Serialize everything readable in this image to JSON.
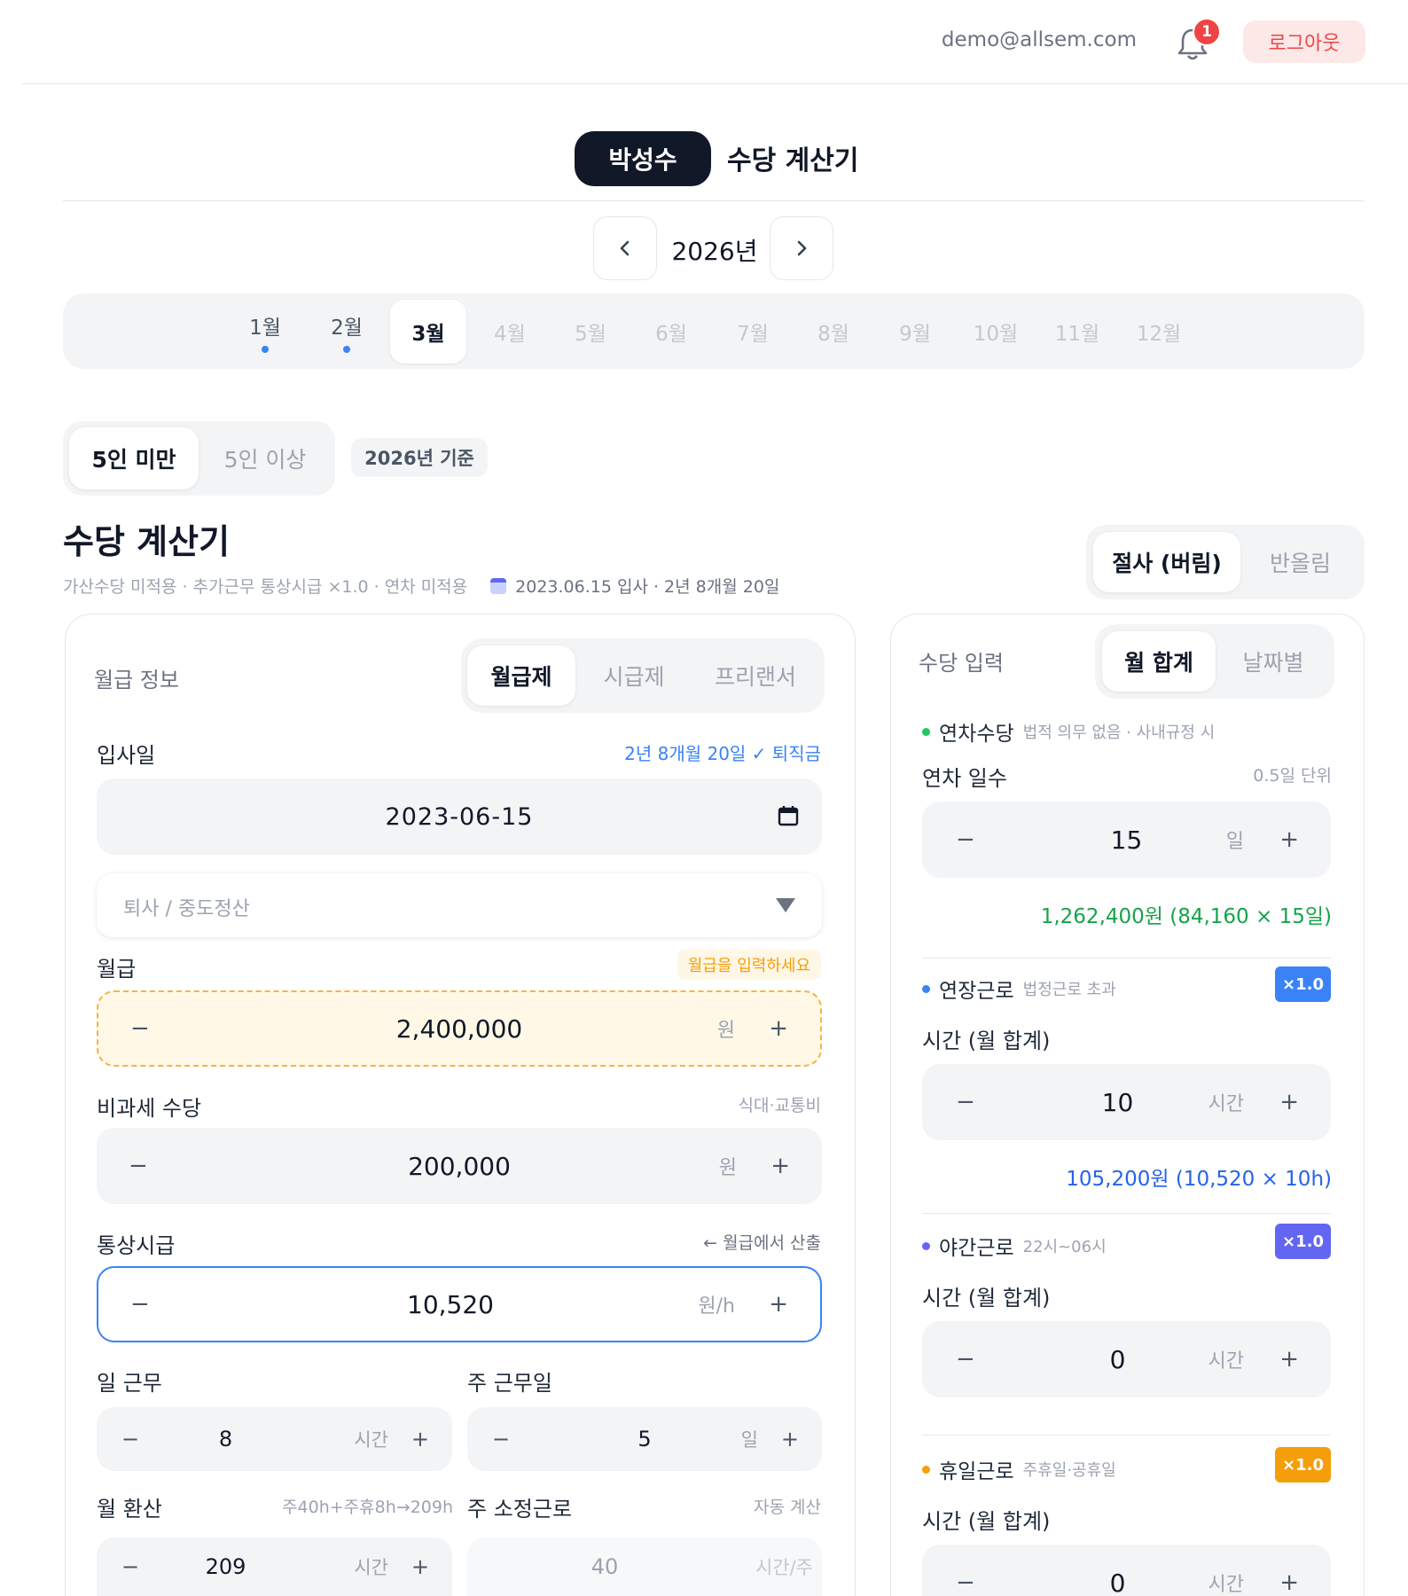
{
  "topbar": {
    "email": "demo@allsem.com",
    "notif_count": "1",
    "logout": "로그아웃"
  },
  "header": {
    "name": "박성수",
    "title": "수당 계산기"
  },
  "year_nav": {
    "prev": "‹",
    "year": "2026년",
    "next": "›"
  },
  "months": [
    {
      "label": "1월",
      "dot": true
    },
    {
      "label": "2월",
      "dot": true
    },
    {
      "label": "3월",
      "active": true
    },
    {
      "label": "4월"
    },
    {
      "label": "5월"
    },
    {
      "label": "6월"
    },
    {
      "label": "7월"
    },
    {
      "label": "8월"
    },
    {
      "label": "9월"
    },
    {
      "label": "10월"
    },
    {
      "label": "11월"
    },
    {
      "label": "12월"
    }
  ],
  "size_toggle": {
    "under5": "5인 미만",
    "over5": "5인 이상",
    "selected": "5인 미만"
  },
  "standard_chip": "2026년 기준",
  "calc": {
    "title": "수당 계산기",
    "subtitle": "가산수당 미적용 · 추가근무 통상시급 ×1.0 · 연차 미적용",
    "hire_info": "2023.06.15 입사 · 2년 8개월 20일"
  },
  "rounding": {
    "floor": "절사 (버림)",
    "round": "반올림",
    "selected": "절사 (버림)"
  },
  "salary": {
    "section": "월급 정보",
    "types": [
      "월급제",
      "시급제",
      "프리랜서"
    ],
    "selected_type": "월급제",
    "hire_date_label": "입사일",
    "hire_date_hint": "2년 8개월 20일 ✓ 퇴직금",
    "hire_date": "2023-06-15",
    "resign_placeholder": "퇴사 / 중도정산",
    "monthly_label": "월급",
    "monthly_hint": "월급을 입력하세요",
    "monthly_value": "2,400,000",
    "won": "원",
    "nontax_label": "비과세 수당",
    "nontax_hint": "식대·교통비",
    "nontax_value": "200,000",
    "hourly_label": "통상시급",
    "hourly_hint": "← 월급에서 산출",
    "hourly_value": "10,520",
    "hourly_unit": "원/h",
    "daily_label": "일 근무",
    "daily_value": "8",
    "daily_unit": "시간",
    "weekdays_label": "주 근무일",
    "weekdays_value": "5",
    "weekdays_unit": "일",
    "monthly_hours_label": "월 환산",
    "monthly_hours_hint": "주40h+주휴8h→209h",
    "monthly_hours_value": "209",
    "monthly_hours_unit": "시간",
    "weekly_label": "주 소정근로",
    "weekly_hint": "자동 계산",
    "weekly_value": "40",
    "weekly_unit": "시간/주",
    "minus": "−",
    "plus": "+"
  },
  "allowance": {
    "section": "수당 입력",
    "modes": [
      "월 합계",
      "날짜별"
    ],
    "selected_mode": "월 합계",
    "items": [
      {
        "name": "연차수당",
        "desc": "법적 의무 없음 · 사내규정 시",
        "color": "#22c55e",
        "field_label": "연차 일수",
        "field_hint": "0.5일 단위",
        "value": "15",
        "unit": "일",
        "result": "1,262,400원 (84,160 × 15일)",
        "result_color": "#16a34a"
      },
      {
        "name": "연장근로",
        "desc": "법정근로 초과",
        "color": "#3b82f6",
        "badge": "×1.0",
        "badge_color": "#3b82f6",
        "field_label": "시간 (월 합계)",
        "value": "10",
        "unit": "시간",
        "result": "105,200원 (10,520 × 10h)",
        "result_color": "#2563eb"
      },
      {
        "name": "야간근로",
        "desc": "22시~06시",
        "color": "#6366f1",
        "badge": "×1.0",
        "badge_color": "#6366f1",
        "field_label": "시간 (월 합계)",
        "value": "0",
        "unit": "시간"
      },
      {
        "name": "휴일근로",
        "desc": "주휴일·공휴일",
        "color": "#f59e0b",
        "badge": "×1.0",
        "badge_color": "#f59e0b",
        "field_label": "시간 (월 합계)",
        "value": "0",
        "unit": "시간"
      }
    ]
  }
}
